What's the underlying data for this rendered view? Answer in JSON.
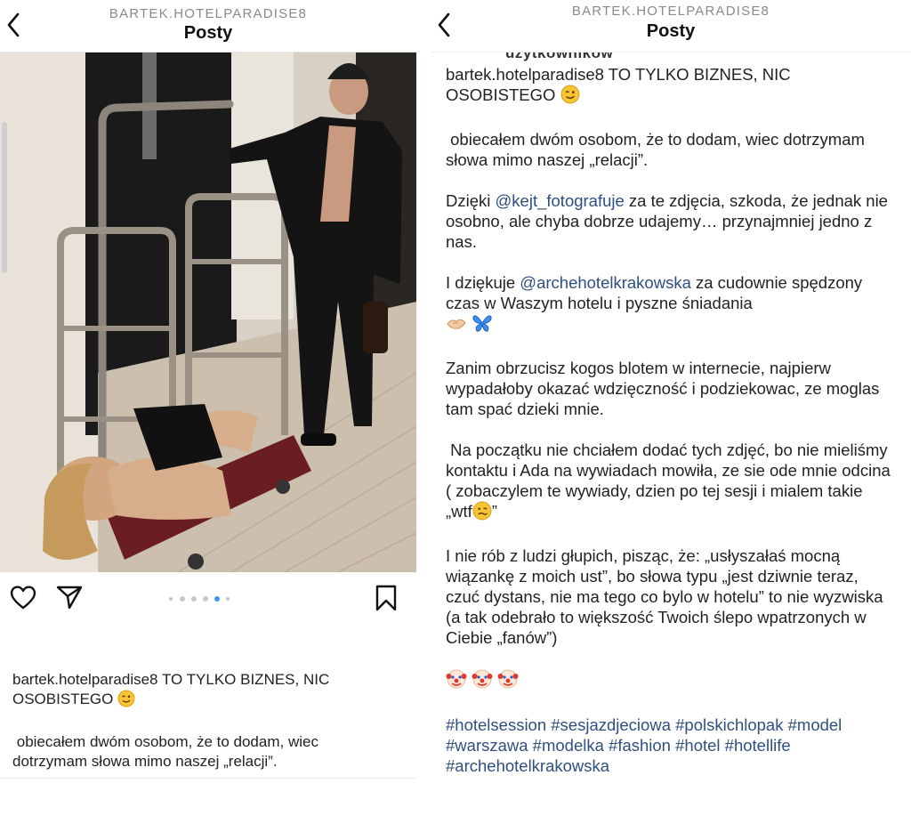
{
  "header": {
    "username": "BARTEK.HOTELPARADISE8",
    "title": "Posty"
  },
  "post": {
    "username": "bartek.hotelparadise8",
    "carousel": {
      "count": 5,
      "active_index": 3
    },
    "caption_line1": "TO TYLKO BIZNES, NIC OSOBISTEGO",
    "para1": "obiecałem dwóm osobom, że to dodam, wiec dotrzymam słowa mimo naszej „relacji”.",
    "para2_before": "Dzięki ",
    "mention1": "@kejt_fotografuje",
    "para2_after": " za te zdjęcia, szkoda, że jednak nie osobno, ale chyba dobrze udajemy… przynajmniej jedno z nas.",
    "para3_before": "I dziękuje ",
    "mention2": "@archehotelkrakowska",
    "para3_after": " za cudownie spędzony czas w Waszym hotelu i pyszne śniadania",
    "para4": "Zanim obrzucisz kogos blotem w internecie, najpierw wypadałoby okazać wdzięczność i podziekowac, ze moglas tam spać dzieki mnie.",
    "para5": "Na początku nie chciałem dodać tych zdjęć, bo nie mieliśmy kontaktu i Ada na wywiadach mowiła, ze sie ode mnie odcina ( zobaczylem te wywiady, dzien po tej sesji i mialem takie „wtf",
    "para5_end": "”",
    "para6": "I nie rób z ludzi głupich, pisząc, że: „usłyszałaś mocną wiązankę z moich ust”, bo słowa typu „jest dziwnie teraz, czuć dystans, nie ma tego co bylo w hotelu” to nie wyzwiska (a tak odebrało to większość Twoich ślepo wpatrzonych w Ciebie „fanów”)",
    "hashtags": "#hotelsession #sesjazdjeciowa #polskichlopak #model #warszawa #modelka #fashion #hotel #hotellife #archehotelkrakowska",
    "cut_text": "użytkowników"
  },
  "icons": [
    "back-chevron-icon",
    "heart-icon",
    "share-icon",
    "bookmark-icon",
    "wink-emoji",
    "handshake-emoji",
    "butterfly-emoji",
    "woozy-emoji",
    "clown-emoji"
  ],
  "colors": {
    "link": "#2f4f7f",
    "dot_active": "#3a97f0",
    "muted": "#8a8a8a"
  }
}
